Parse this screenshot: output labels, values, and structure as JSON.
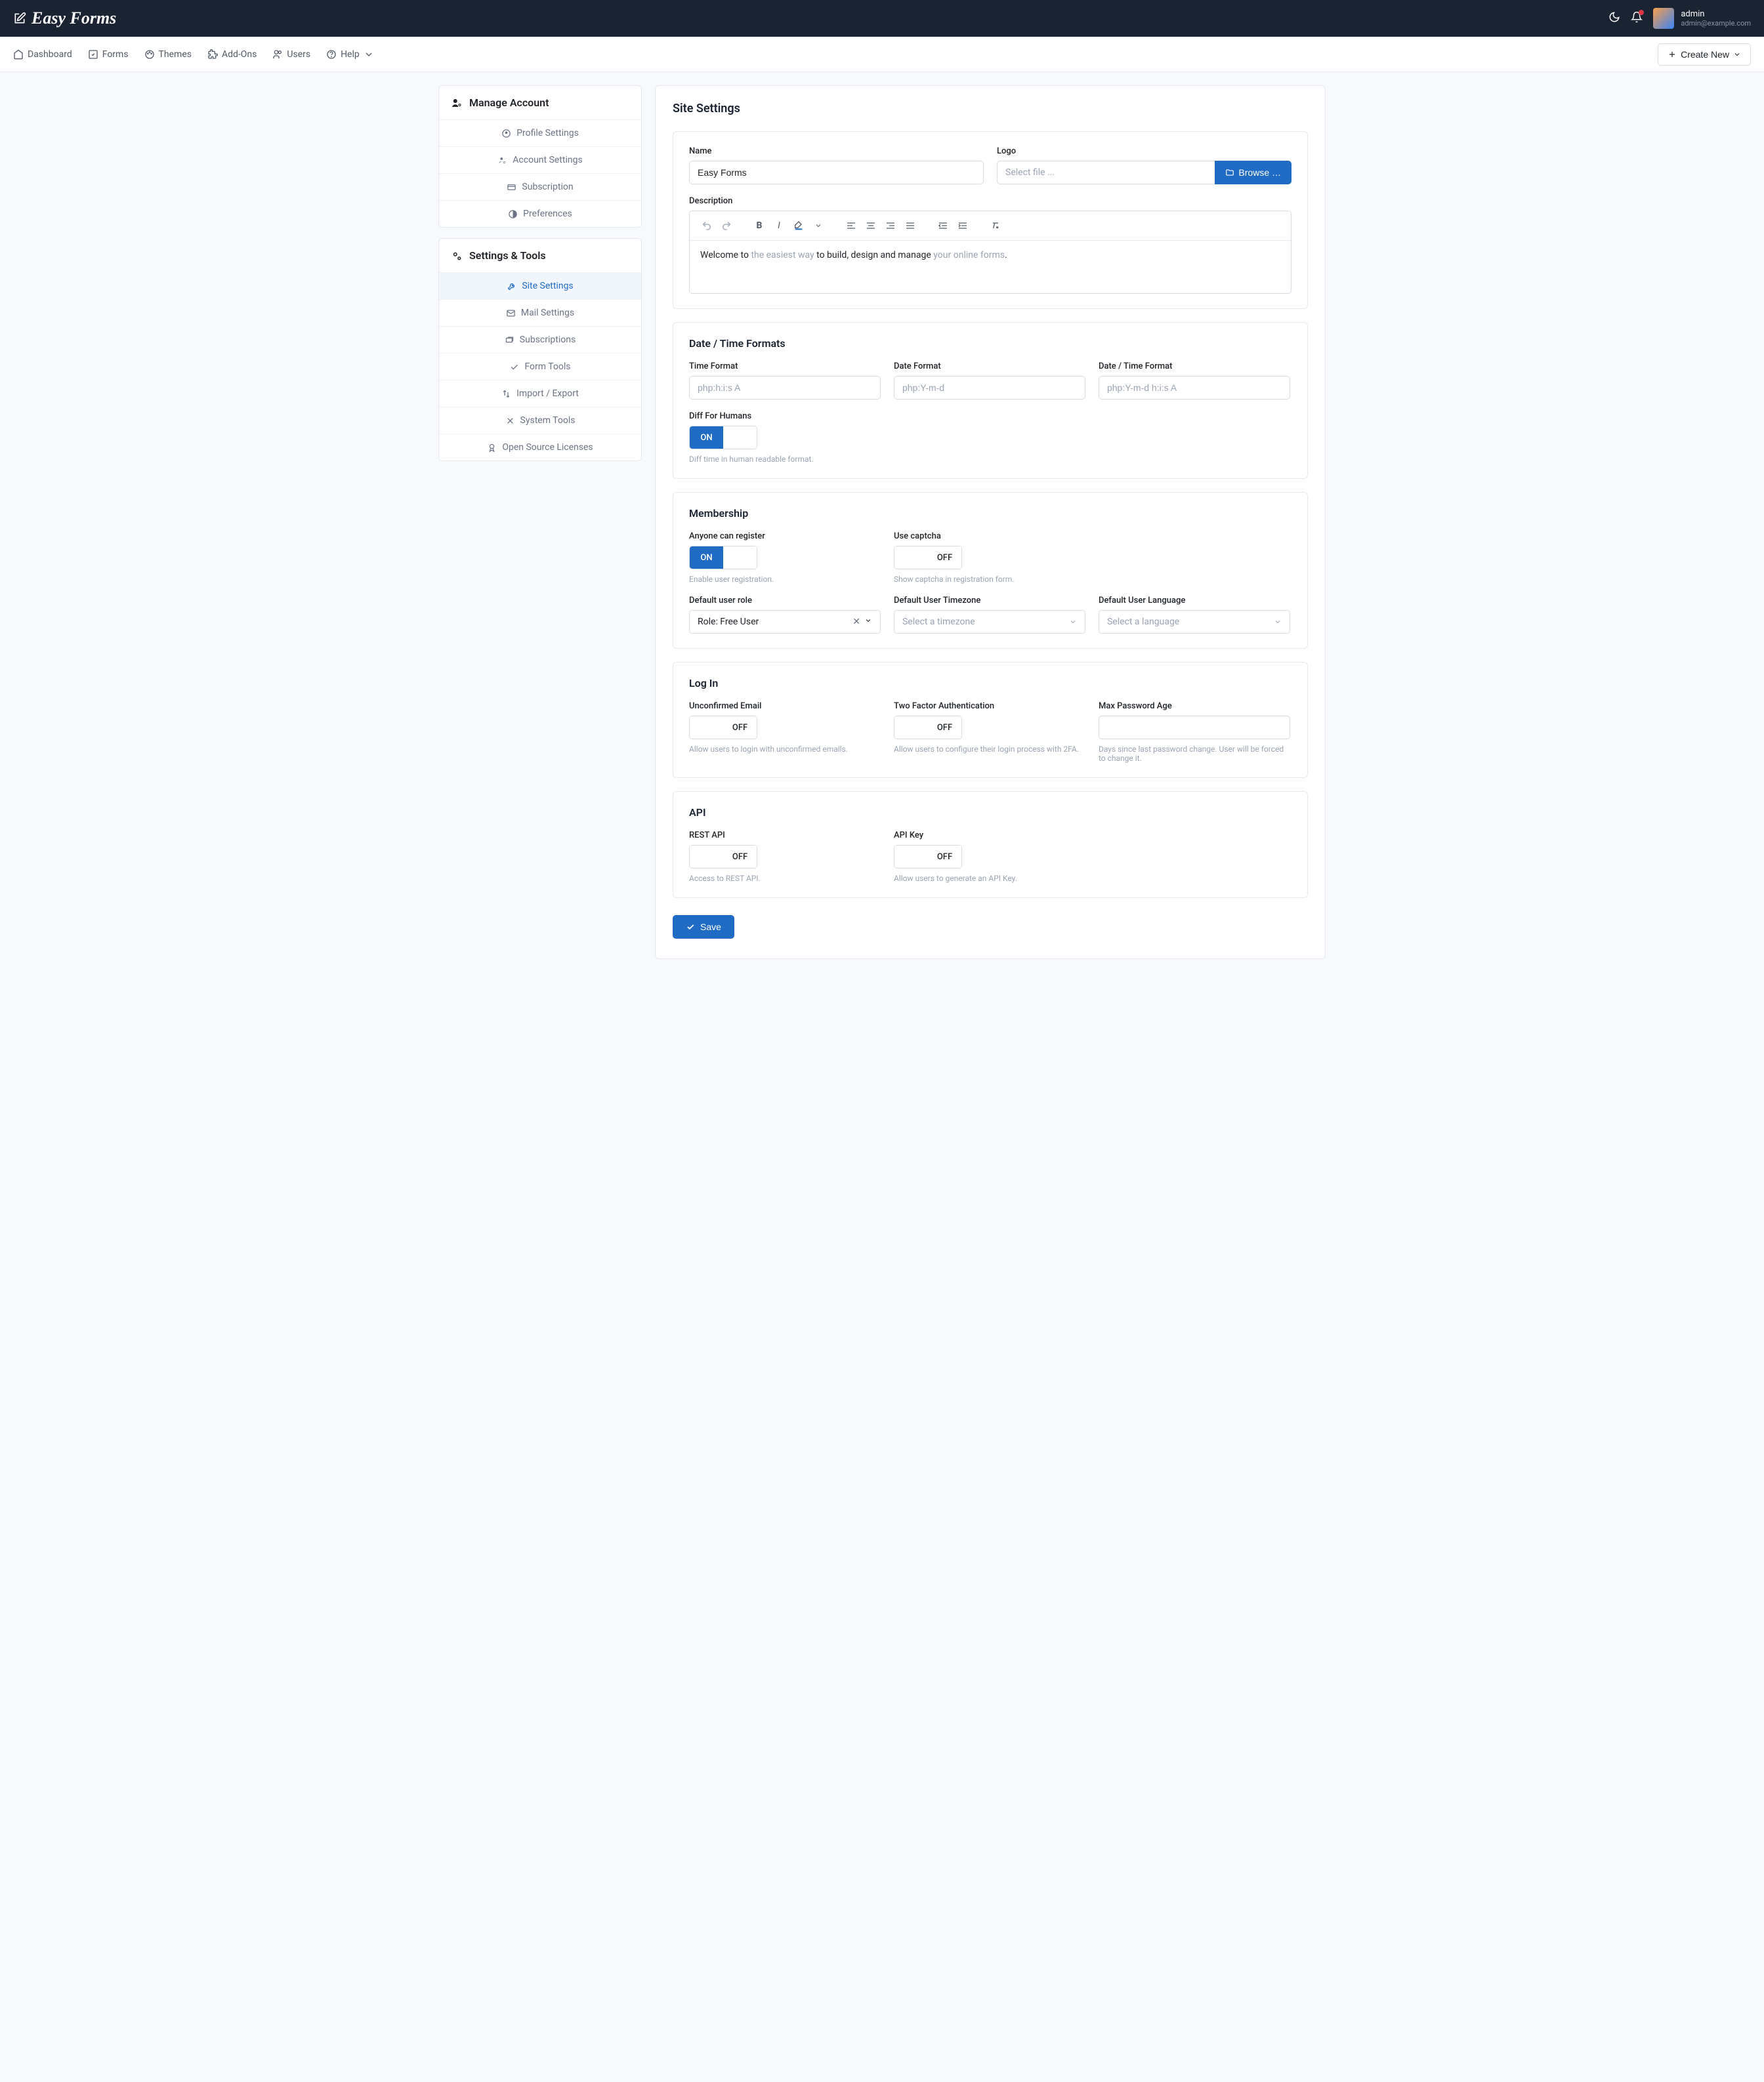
{
  "brand": "Easy Forms",
  "user": {
    "name": "admin",
    "email": "admin@example.com"
  },
  "nav": {
    "dashboard": "Dashboard",
    "forms": "Forms",
    "themes": "Themes",
    "addons": "Add-Ons",
    "users": "Users",
    "help": "Help",
    "create": "Create New"
  },
  "sidebar": {
    "manage_title": "Manage Account",
    "manage": {
      "profile": "Profile Settings",
      "account": "Account Settings",
      "subscription": "Subscription",
      "preferences": "Preferences"
    },
    "settings_title": "Settings & Tools",
    "settings": {
      "site": "Site Settings",
      "mail": "Mail Settings",
      "subscriptions": "Subscriptions",
      "formtools": "Form Tools",
      "import": "Import / Export",
      "systemtools": "System Tools",
      "licenses": "Open Source Licenses"
    }
  },
  "page": {
    "title": "Site Settings",
    "name_label": "Name",
    "name_value": "Easy Forms",
    "logo_label": "Logo",
    "logo_placeholder": "Select file ...",
    "browse": "Browse …",
    "desc_label": "Description",
    "desc_text1": "Welcome to ",
    "desc_link1": "the easiest way",
    "desc_text2": " to build, design and manage ",
    "desc_link2": "your online forms",
    "desc_text3": "."
  },
  "datetime": {
    "title": "Date / Time Formats",
    "time_label": "Time Format",
    "time_ph": "php:h:i:s A",
    "date_label": "Date Format",
    "date_ph": "php:Y-m-d",
    "dt_label": "Date / Time Format",
    "dt_ph": "php:Y-m-d h:i:s A",
    "diff_label": "Diff For Humans",
    "diff_hint": "Diff time in human readable format.",
    "on": "ON",
    "off": "OFF"
  },
  "membership": {
    "title": "Membership",
    "register_label": "Anyone can register",
    "register_hint": "Enable user registration.",
    "captcha_label": "Use captcha",
    "captcha_hint": "Show captcha in registration form.",
    "role_label": "Default user role",
    "role_value": "Role: Free User",
    "tz_label": "Default User Timezone",
    "tz_ph": "Select a timezone",
    "lang_label": "Default User Language",
    "lang_ph": "Select a language"
  },
  "login": {
    "title": "Log In",
    "unconf_label": "Unconfirmed Email",
    "unconf_hint": "Allow users to login with unconfirmed emails.",
    "tfa_label": "Two Factor Authentication",
    "tfa_hint": "Allow users to configure their login process with 2FA.",
    "maxpw_label": "Max Password Age",
    "maxpw_hint": "Days since last password change. User will be forced to change it."
  },
  "api": {
    "title": "API",
    "rest_label": "REST API",
    "rest_hint": "Access to REST API.",
    "key_label": "API Key",
    "key_hint": "Allow users to generate an API Key."
  },
  "save": "Save"
}
